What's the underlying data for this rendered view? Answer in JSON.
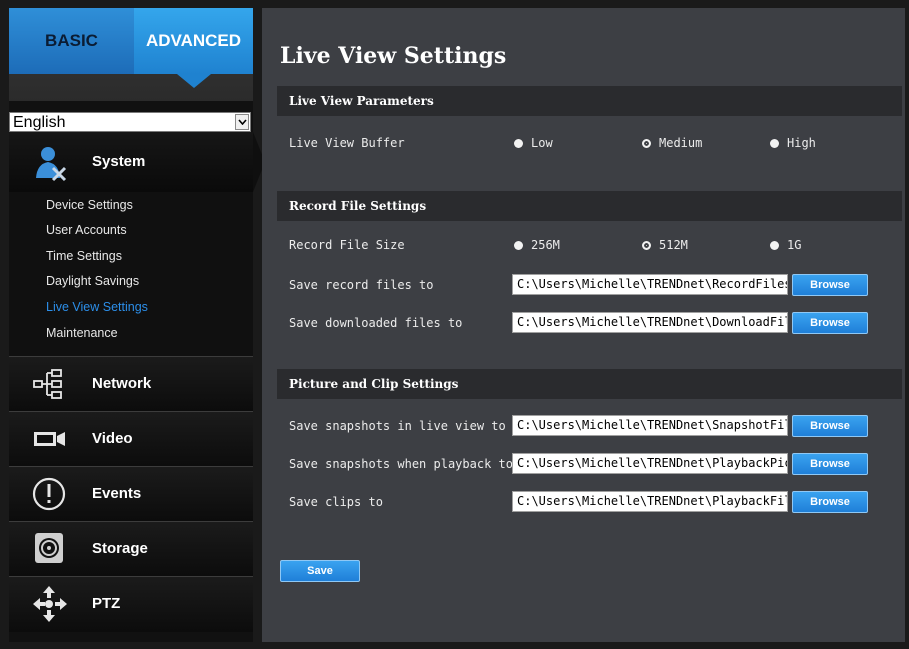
{
  "tabs": {
    "basic": "BASIC",
    "advanced": "ADVANCED"
  },
  "language": {
    "selected": "English"
  },
  "sidebar": {
    "system": "System",
    "submenu": [
      "Device Settings",
      "User Accounts",
      "Time Settings",
      "Daylight Savings",
      "Live View Settings",
      "Maintenance"
    ],
    "active_item": "Live View Settings",
    "sections": {
      "network": "Network",
      "video": "Video",
      "events": "Events",
      "storage": "Storage",
      "ptz": "PTZ"
    },
    "icons": {
      "system": "system-tools-icon",
      "network": "network-icon",
      "video": "video-camera-icon",
      "events": "alert-icon",
      "storage": "storage-disk-icon",
      "ptz": "ptz-arrows-icon"
    }
  },
  "main": {
    "title": "Live View Settings",
    "live_view": {
      "header": "Live View Parameters",
      "buffer_label": "Live View Buffer",
      "options": [
        "Low",
        "Medium",
        "High"
      ],
      "selected": "Medium"
    },
    "record": {
      "header": "Record File Settings",
      "size_label": "Record File Size",
      "options": [
        "256M",
        "512M",
        "1G"
      ],
      "selected": "512M",
      "save_record_label": "Save record files to",
      "save_record_path": "C:\\Users\\Michelle\\TRENDnet\\RecordFiles",
      "save_download_label": "Save downloaded files to",
      "save_download_path": "C:\\Users\\Michelle\\TRENDnet\\DownloadFiles"
    },
    "picture": {
      "header": "Picture and Clip Settings",
      "snap_live_label": "Save snapshots in live view to",
      "snap_live_path": "C:\\Users\\Michelle\\TRENDnet\\SnapshotFiles",
      "snap_playback_label": "Save snapshots when playback to",
      "snap_playback_path": "C:\\Users\\Michelle\\TRENDnet\\PlaybackPics",
      "clips_label": "Save clips to",
      "clips_path": "C:\\Users\\Michelle\\TRENDnet\\PlaybackFiles"
    },
    "browse_label": "Browse",
    "save_label": "Save"
  },
  "colors": {
    "accent": "#1f82d0",
    "active_link": "#2c8ee8",
    "panel": "#3d3f44",
    "section_bar": "#2a2b2e"
  }
}
